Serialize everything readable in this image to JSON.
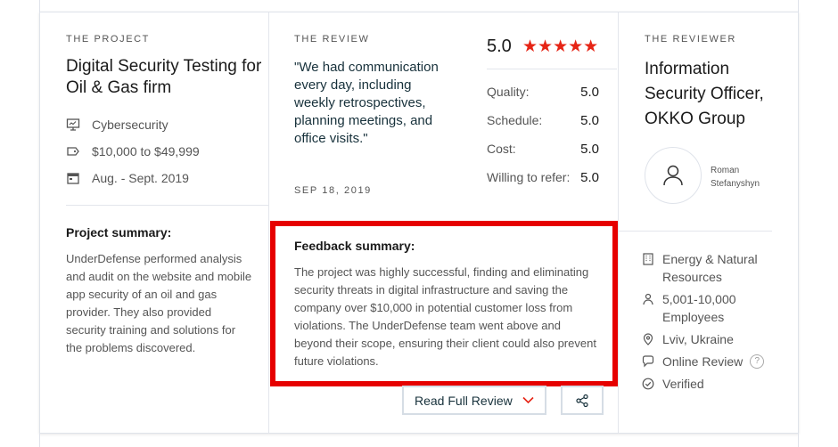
{
  "project": {
    "eyebrow": "THE PROJECT",
    "title": "Digital Security Testing for Oil & Gas firm",
    "category": "Cybersecurity",
    "budget": "$10,000 to $49,999",
    "dates": "Aug. - Sept. 2019",
    "summary_title": "Project summary:",
    "summary_body": "UnderDefense performed analysis and audit on the website and mobile app security of an oil and gas provider. They also provided security training and solutions for the problems discovered."
  },
  "review": {
    "eyebrow": "THE REVIEW",
    "quote": "\"We had communication every day, including weekly retrospectives, planning meetings, and office visits.\"",
    "date": "SEP 18, 2019",
    "overall": "5.0",
    "stars": "★★★★★",
    "ratings": [
      {
        "label": "Quality:",
        "value": "5.0"
      },
      {
        "label": "Schedule:",
        "value": "5.0"
      },
      {
        "label": "Cost:",
        "value": "5.0"
      },
      {
        "label": "Willing to refer:",
        "value": "5.0"
      }
    ],
    "feedback_title": "Feedback summary:",
    "feedback_body": "The project was highly successful, finding and eliminating security threats in digital infrastructure and saving the company over $10,000 in potential customer loss from violations. The UnderDefense team went above and beyond their scope, ensuring their client could also prevent future violations.",
    "read_full_label": "Read Full Review"
  },
  "reviewer": {
    "eyebrow": "THE REVIEWER",
    "title": "Information Security Officer, OKKO Group",
    "name": "Roman Stefanyshyn",
    "industry": "Energy & Natural Resources",
    "employees": "5,001-10,000 Employees",
    "location": "Lviv, Ukraine",
    "review_type": "Online Review",
    "help": "?",
    "verified": "Verified"
  },
  "colors": {
    "star": "#e62415",
    "highlight_border": "#e60000",
    "accent_chevron": "#e62415"
  }
}
